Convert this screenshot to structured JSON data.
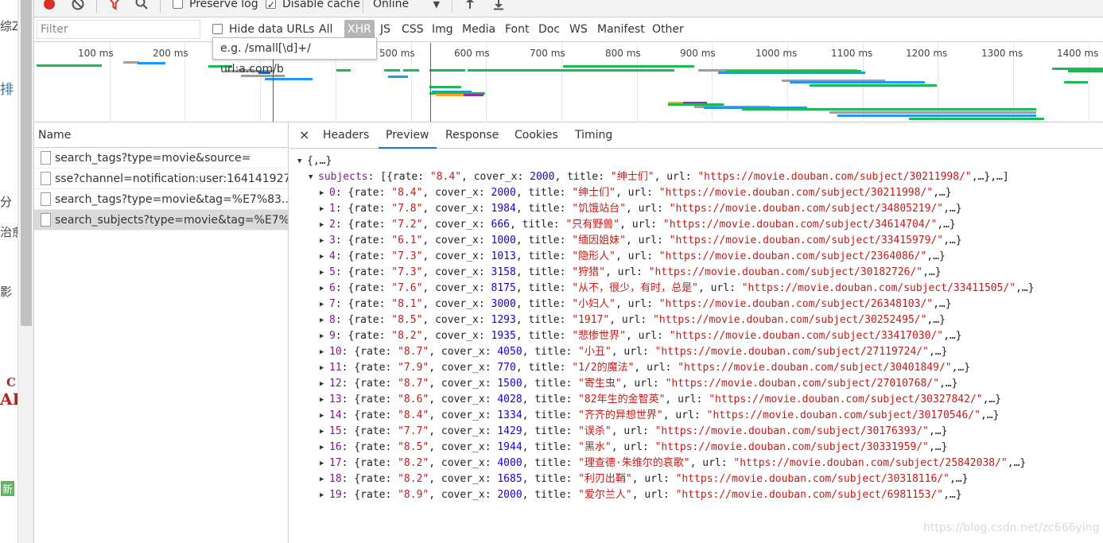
{
  "page_strip": {
    "fragments": [
      {
        "text": "综Z",
        "color": "#444444"
      },
      {
        "text": "排",
        "color": "#3b6ea5"
      },
      {
        "text": "分",
        "color": "#444444"
      },
      {
        "text": "治愈",
        "color": "#444444"
      },
      {
        "text": "影",
        "color": "#444444"
      },
      {
        "text": "C",
        "color": "#b22222"
      },
      {
        "text": "AI",
        "color": "#b22222"
      },
      {
        "text": "新",
        "color": "#ffffff"
      }
    ]
  },
  "toolbar": {
    "preserve_log": "Preserve log",
    "disable_cache": "Disable cache",
    "throttling": "Online"
  },
  "filterbar": {
    "filter_placeholder": "Filter",
    "hide_data_urls": "Hide data URLs",
    "type_filters": [
      "All",
      "XHR",
      "JS",
      "CSS",
      "Img",
      "Media",
      "Font",
      "Doc",
      "WS",
      "Manifest",
      "Other"
    ],
    "active_filter": "XHR",
    "tooltip": "e.g. /small[\\d]+/ url:a.com/b"
  },
  "overview": {
    "ticks": [
      "100 ms",
      "200 ms",
      "300 ms",
      "400 ms",
      "500 ms",
      "600 ms",
      "700 ms",
      "800 ms",
      "900 ms",
      "1000 ms",
      "1100 ms",
      "1200 ms",
      "1300 ms",
      "1400 ms"
    ],
    "colors": {
      "receive": "#1db954",
      "wait": "#2196f3",
      "queue": "#9e9e9e",
      "dom": "#1565c0",
      "load": "#d32f2f",
      "orange": "#f5a623",
      "purple": "#9c27b0"
    }
  },
  "name_panel": {
    "header": "Name",
    "requests": [
      "search_tags?type=movie&source=",
      "sse?channel=notification:user:164141927...",
      "search_tags?type=movie&tag=%E7%83...",
      "search_subjects?type=movie&tag=%E7%..."
    ],
    "selected_index": 3
  },
  "detail": {
    "close": "×",
    "tabs": [
      "Headers",
      "Preview",
      "Response",
      "Cookies",
      "Timing"
    ],
    "active_tab": "Preview"
  },
  "preview": {
    "root": "{,…}",
    "subjects_key": "subjects",
    "subjects_summary_pre": "[{rate: ",
    "subjects_summary_rate": "\"8.4\"",
    "subjects_summary_mid1": ", cover_x: ",
    "subjects_summary_cover": "2000",
    "subjects_summary_mid2": ", title: ",
    "subjects_summary_title": "\"绅士们\"",
    "subjects_summary_mid3": ", url: ",
    "subjects_summary_url": "\"https://movie.douban.com/subject/30211998/\"",
    "subjects_summary_end": ",…},…]",
    "items": [
      {
        "idx": "0",
        "rate": "\"8.4\"",
        "cover_x": "2000",
        "title": "\"绅士们\"",
        "url": "\"https://movie.douban.com/subject/30211998/\""
      },
      {
        "idx": "1",
        "rate": "\"7.8\"",
        "cover_x": "1984",
        "title": "\"饥饿站台\"",
        "url": "\"https://movie.douban.com/subject/34805219/\""
      },
      {
        "idx": "2",
        "rate": "\"7.2\"",
        "cover_x": "666",
        "title": "\"只有野兽\"",
        "url": "\"https://movie.douban.com/subject/34614704/\""
      },
      {
        "idx": "3",
        "rate": "\"6.1\"",
        "cover_x": "1000",
        "title": "\"缅因姐妹\"",
        "url": "\"https://movie.douban.com/subject/33415979/\""
      },
      {
        "idx": "4",
        "rate": "\"7.3\"",
        "cover_x": "1013",
        "title": "\"隐形人\"",
        "url": "\"https://movie.douban.com/subject/2364086/\""
      },
      {
        "idx": "5",
        "rate": "\"7.3\"",
        "cover_x": "3158",
        "title": "\"狩猎\"",
        "url": "\"https://movie.douban.com/subject/30182726/\""
      },
      {
        "idx": "6",
        "rate": "\"7.6\"",
        "cover_x": "8175",
        "title": "\"从不，很少，有时，总是\"",
        "url": "\"https://movie.douban.com/subject/33411505/\""
      },
      {
        "idx": "7",
        "rate": "\"8.1\"",
        "cover_x": "3000",
        "title": "\"小妇人\"",
        "url": "\"https://movie.douban.com/subject/26348103/\""
      },
      {
        "idx": "8",
        "rate": "\"8.5\"",
        "cover_x": "1293",
        "title": "\"1917\"",
        "url": "\"https://movie.douban.com/subject/30252495/\""
      },
      {
        "idx": "9",
        "rate": "\"8.2\"",
        "cover_x": "1935",
        "title": "\"悲惨世界\"",
        "url": "\"https://movie.douban.com/subject/33417030/\""
      },
      {
        "idx": "10",
        "rate": "\"8.7\"",
        "cover_x": "4050",
        "title": "\"小丑\"",
        "url": "\"https://movie.douban.com/subject/27119724/\""
      },
      {
        "idx": "11",
        "rate": "\"7.9\"",
        "cover_x": "770",
        "title": "\"1/2的魔法\"",
        "url": "\"https://movie.douban.com/subject/30401849/\""
      },
      {
        "idx": "12",
        "rate": "\"8.7\"",
        "cover_x": "1500",
        "title": "\"寄生虫\"",
        "url": "\"https://movie.douban.com/subject/27010768/\""
      },
      {
        "idx": "13",
        "rate": "\"8.6\"",
        "cover_x": "4028",
        "title": "\"82年生的金智英\"",
        "url": "\"https://movie.douban.com/subject/30327842/\""
      },
      {
        "idx": "14",
        "rate": "\"8.4\"",
        "cover_x": "1334",
        "title": "\"齐齐的异想世界\"",
        "url": "\"https://movie.douban.com/subject/30170546/\""
      },
      {
        "idx": "15",
        "rate": "\"7.7\"",
        "cover_x": "1429",
        "title": "\"误杀\"",
        "url": "\"https://movie.douban.com/subject/30176393/\""
      },
      {
        "idx": "16",
        "rate": "\"8.5\"",
        "cover_x": "1944",
        "title": "\"黑水\"",
        "url": "\"https://movie.douban.com/subject/30331959/\""
      },
      {
        "idx": "17",
        "rate": "\"8.2\"",
        "cover_x": "4000",
        "title": "\"理查德·朱维尔的哀歌\"",
        "url": "\"https://movie.douban.com/subject/25842038/\""
      },
      {
        "idx": "18",
        "rate": "\"8.2\"",
        "cover_x": "1685",
        "title": "\"利刃出鞘\"",
        "url": "\"https://movie.douban.com/subject/30318116/\""
      },
      {
        "idx": "19",
        "rate": "\"8.9\"",
        "cover_x": "2000",
        "title": "\"爱尔兰人\"",
        "url": "\"https://movie.douban.com/subject/6981153/\""
      }
    ]
  },
  "watermark": "https://blog.csdn.net/zc666ying"
}
